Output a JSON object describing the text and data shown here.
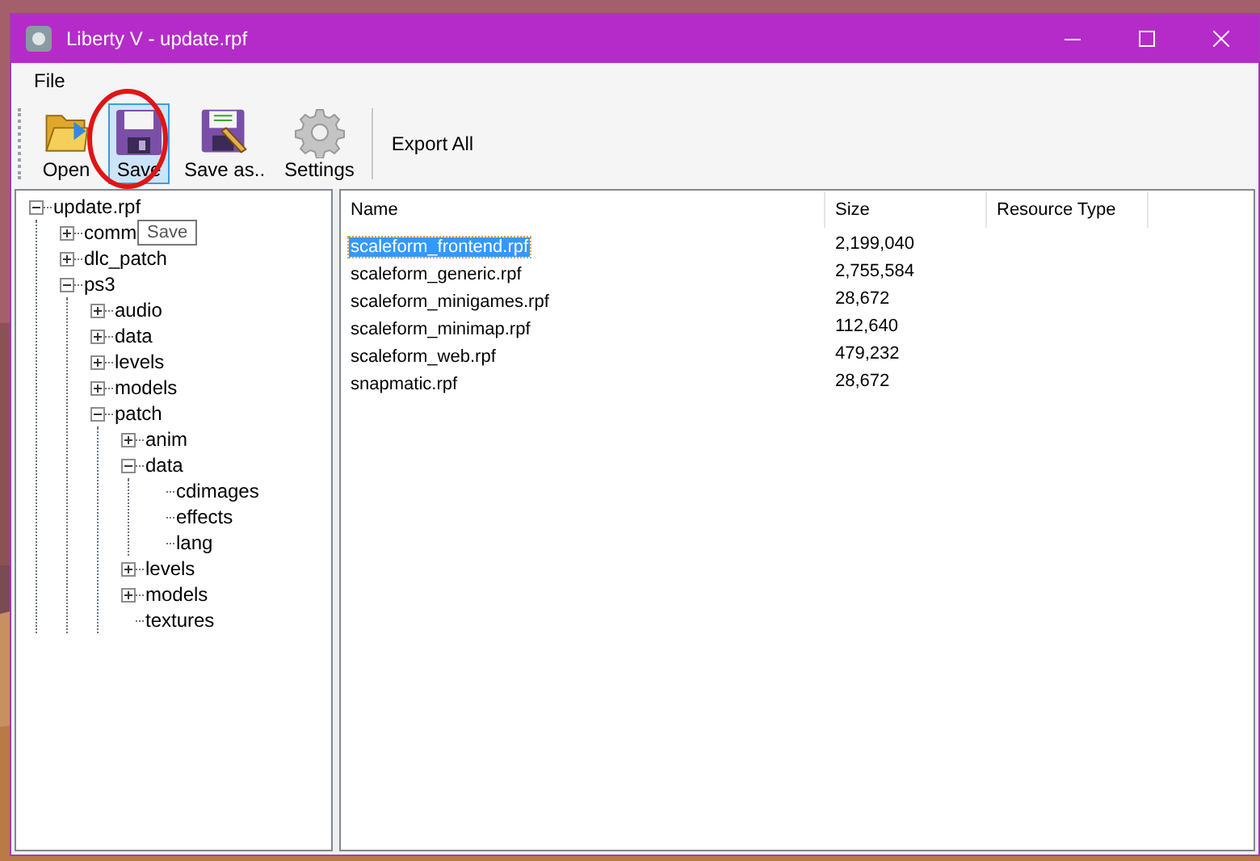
{
  "window": {
    "title": "Liberty V - update.rpf"
  },
  "menu": [
    "File"
  ],
  "toolbar": [
    {
      "kind": "open",
      "label": "Open",
      "highlighted": false
    },
    {
      "kind": "save",
      "label": "Save",
      "highlighted": true
    },
    {
      "kind": "saveas",
      "label": "Save as..",
      "highlighted": false
    },
    {
      "kind": "settings",
      "label": "Settings",
      "highlighted": false
    },
    {
      "kind": "text",
      "label": "Export All",
      "highlighted": false
    }
  ],
  "tooltip": "Save",
  "tree": [
    {
      "label": "update.rpf",
      "expanded": true,
      "children": [
        {
          "label": "comm",
          "expanded": false
        },
        {
          "label": "dlc_patch",
          "expanded": false
        },
        {
          "label": "ps3",
          "expanded": true,
          "children": [
            {
              "label": "audio",
              "expanded": false
            },
            {
              "label": "data",
              "expanded": false
            },
            {
              "label": "levels",
              "expanded": false
            },
            {
              "label": "models",
              "expanded": false
            },
            {
              "label": "patch",
              "expanded": true,
              "children": [
                {
                  "label": "anim",
                  "expanded": false
                },
                {
                  "label": "data",
                  "expanded": true,
                  "children": [
                    {
                      "label": "cdimages"
                    },
                    {
                      "label": "effects"
                    },
                    {
                      "label": "lang"
                    }
                  ]
                },
                {
                  "label": "levels",
                  "expanded": false
                },
                {
                  "label": "models",
                  "expanded": false
                },
                {
                  "label": "textures"
                }
              ]
            }
          ]
        }
      ]
    }
  ],
  "table": {
    "columns": [
      "Name",
      "Size",
      "Resource Type"
    ],
    "rows": [
      {
        "name": "scaleform_frontend.rpf",
        "size": "2,199,040",
        "selected": true
      },
      {
        "name": "scaleform_generic.rpf",
        "size": "2,755,584",
        "selected": false
      },
      {
        "name": "scaleform_minigames.rpf",
        "size": "28,672",
        "selected": false
      },
      {
        "name": "scaleform_minimap.rpf",
        "size": "112,640",
        "selected": false
      },
      {
        "name": "scaleform_web.rpf",
        "size": "479,232",
        "selected": false
      },
      {
        "name": "snapmatic.rpf",
        "size": "28,672",
        "selected": false
      }
    ]
  }
}
